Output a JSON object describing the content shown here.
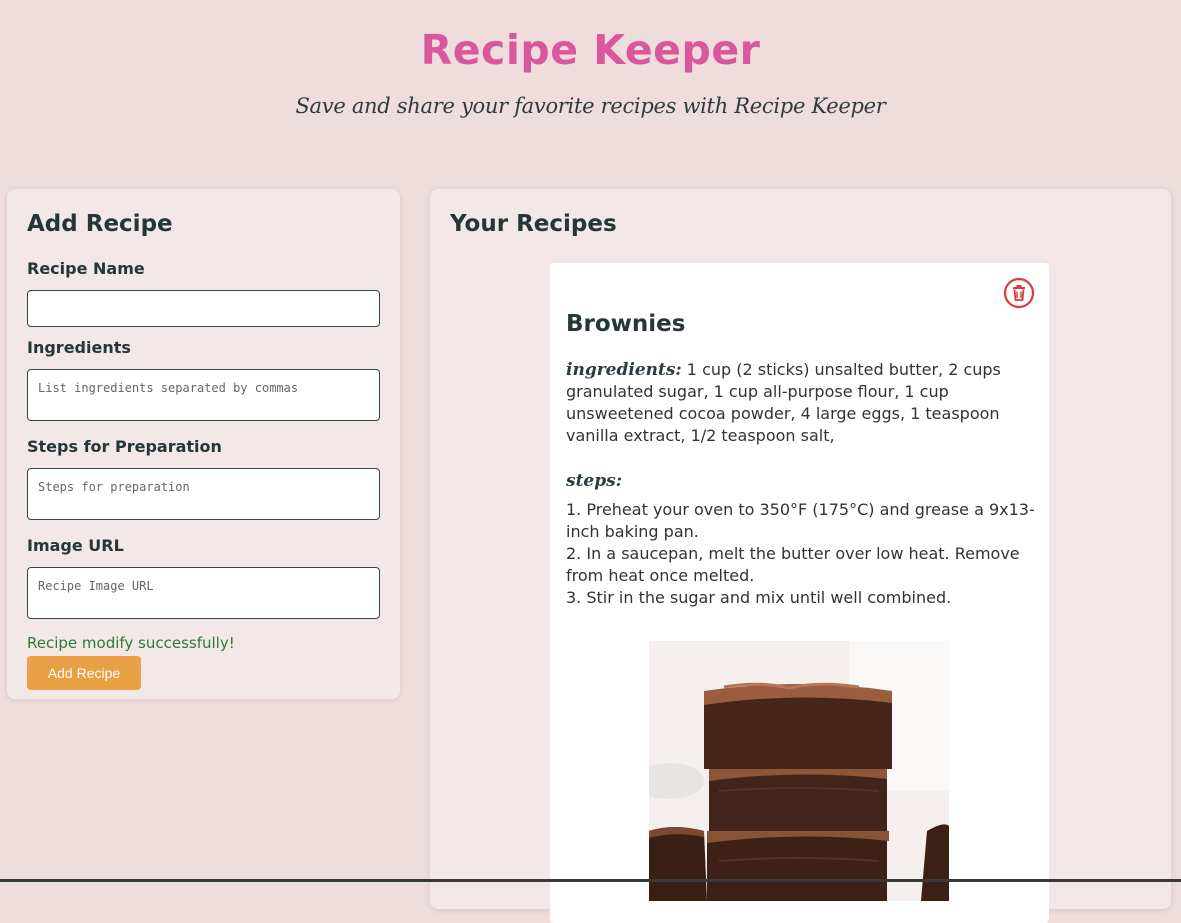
{
  "header": {
    "title": "Recipe Keeper",
    "subtitle": "Save and share your favorite recipes with Recipe Keeper"
  },
  "add_form": {
    "title": "Add Recipe",
    "name_label": "Recipe Name",
    "name_value": "",
    "ingredients_label": "Ingredients",
    "ingredients_placeholder": "List ingredients separated by commas",
    "steps_label": "Steps for Preparation",
    "steps_placeholder": "Steps for preparation",
    "image_label": "Image URL",
    "image_placeholder": "Recipe Image URL",
    "success_message": "Recipe modify successfully!",
    "submit_label": "Add Recipe"
  },
  "recipes": {
    "title": "Your Recipes",
    "items": [
      {
        "name": "Brownies",
        "ingredients_label": "ingredients:",
        "ingredients": "1 cup (2 sticks) unsalted butter, 2 cups granulated sugar, 1 cup all-purpose flour, 1 cup unsweetened cocoa powder, 4 large eggs, 1 teaspoon vanilla extract, 1/2 teaspoon salt,",
        "steps_label": "steps:",
        "steps": [
          "1. Preheat your oven to 350°F (175°C) and grease a 9x13-inch baking pan.",
          "2. In a saucepan, melt the butter over low heat. Remove from heat once melted.",
          "3. Stir in the sugar and mix until well combined."
        ],
        "delete_icon": "trash-icon",
        "image": "brownies-stack-photo"
      }
    ]
  },
  "colors": {
    "background": "#efdcdc",
    "title_pink": "#d9579a",
    "button_orange": "#e9a044",
    "success_green": "#2f7a33",
    "delete_red": "#d93a3a"
  }
}
